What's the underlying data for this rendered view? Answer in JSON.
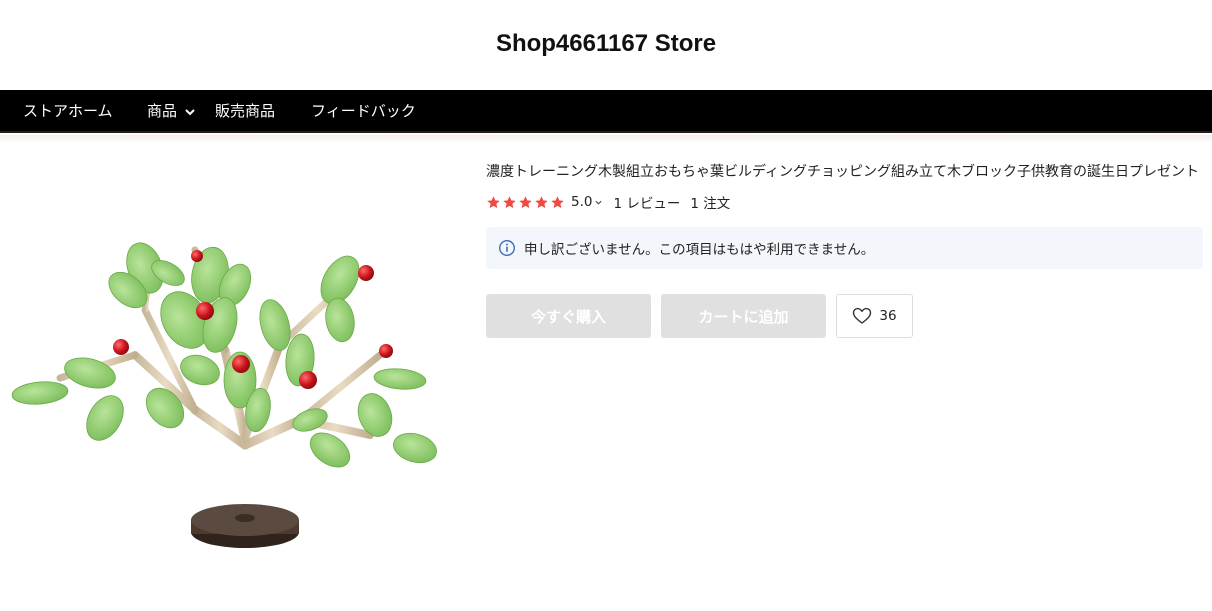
{
  "store": {
    "name": "Shop4661167 Store"
  },
  "nav": {
    "items": [
      {
        "label": "ストアホーム"
      },
      {
        "label": "商品"
      },
      {
        "label": "販売商品"
      },
      {
        "label": "フィードバック"
      }
    ]
  },
  "product": {
    "title": "濃度トレーニング木製組立おもちゃ葉ビルディングチョッピング組み立て木ブロック子供教育の誕生日プレゼント",
    "rating": {
      "stars": 5,
      "value": "5.0",
      "reviews": "1 レビュー",
      "orders": "1 注文",
      "star_color": "#f04a45"
    },
    "notice": "申し訳ございません。この項目はもはや利用できません。",
    "buttons": {
      "buy_now": "今すぐ購入",
      "add_to_cart": "カートに追加",
      "wishlist_count": "36"
    }
  },
  "colors": {
    "nav_bg": "#000000",
    "notice_bg": "#f3f6fb",
    "info_icon": "#3b6fb6"
  }
}
